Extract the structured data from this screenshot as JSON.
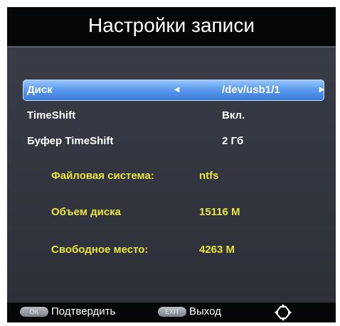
{
  "header": {
    "title": "Настройки записи"
  },
  "settings": [
    {
      "label": "Диск",
      "value": "/dev/usb1/1",
      "selected": true
    },
    {
      "label": "TimeShift",
      "value": "Вкл."
    },
    {
      "label": "Буфер TimeShift",
      "value": "2 Гб"
    }
  ],
  "info": [
    {
      "label": "Файловая система:",
      "value": "ntfs"
    },
    {
      "label": "Объем диска",
      "value": "15116 M"
    },
    {
      "label": "Свободное место:",
      "value": "4263 M"
    }
  ],
  "footer": {
    "ok_key": "OK",
    "confirm_label": "Подтвердить",
    "exit_key": "EXIT",
    "exit_label": "Выход"
  },
  "icons": {
    "left_arrow": "◄",
    "right_arrow": "►",
    "navigation": "navigation-diamond-icon"
  },
  "colors": {
    "highlight": "#5d9cf0",
    "info_text": "#e8e63a",
    "background": "#2c2f38"
  }
}
